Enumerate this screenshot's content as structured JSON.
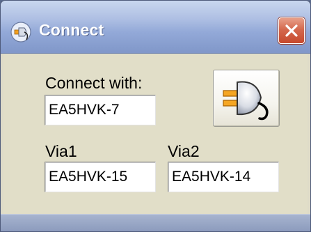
{
  "window": {
    "title": "Connect",
    "title_icon": "connect-plug-icon",
    "close_icon": "close-icon"
  },
  "form": {
    "connect_with_label": "Connect with:",
    "connect_with_value": "EA5HVK-7",
    "via1_label": "Via1",
    "via1_value": "EA5HVK-15",
    "via2_label": "Via2",
    "via2_value": "EA5HVK-14"
  },
  "connect_button": {
    "icon": "plug-connect-icon"
  },
  "colors": {
    "titlebar": "#93a9d8",
    "close_button": "#d4694e",
    "client_background": "#e1dec8",
    "plug_orange": "#f0a020"
  }
}
